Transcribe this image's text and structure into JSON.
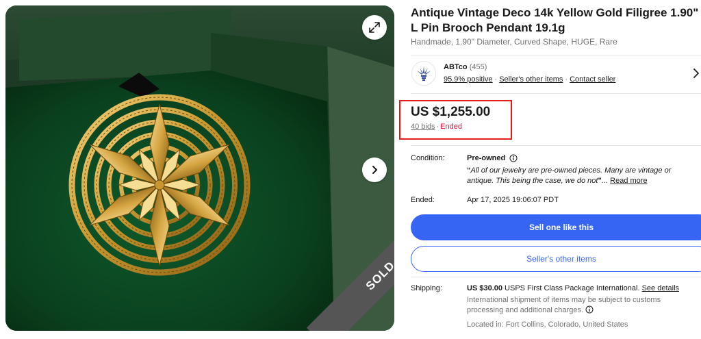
{
  "listing": {
    "title": "Antique Vintage Deco 14k Yellow Gold Filigree 1.90\" L Pin Brooch Pendant 19.1g",
    "subtitle": "Handmade, 1.90\" Diameter, Curved Shape, HUGE, Rare"
  },
  "gallery": {
    "sold_label": "SOLD",
    "expand_icon": "expand-icon",
    "next_icon": "chevron-right-icon"
  },
  "seller": {
    "name": "ABTco",
    "feedback_count": "(455)",
    "positive": "95.9% positive",
    "other_items_link": "Seller's other items",
    "contact_link": "Contact seller"
  },
  "price": {
    "amount": "US $1,255.00",
    "bids": "40 bids",
    "separator": "·",
    "status": "Ended",
    "status_color": "#e0103a",
    "highlight_color": "#e21b1b"
  },
  "condition": {
    "label": "Condition:",
    "value": "Pre-owned",
    "quote_open": "“",
    "description": "All of our jewelry are pre-owned pieces. Many are vintage or antique. This being the case, we do not",
    "quote_close": "”",
    "ellipsis": "...",
    "read_more": "Read more"
  },
  "ended": {
    "label": "Ended:",
    "value": "Apr 17, 2025 19:06:07 PDT"
  },
  "actions": {
    "sell_one": "Sell one like this",
    "sellers_other_items": "Seller's other items",
    "primary_color": "#3665f3"
  },
  "shipping": {
    "label": "Shipping:",
    "amount": "US $30.00",
    "method": "USPS First Class Package International.",
    "see_details": "See details",
    "note": "International shipment of items may be subject to customs processing and additional charges.",
    "location": "Located in: Fort Collins, Colorado, United States"
  }
}
